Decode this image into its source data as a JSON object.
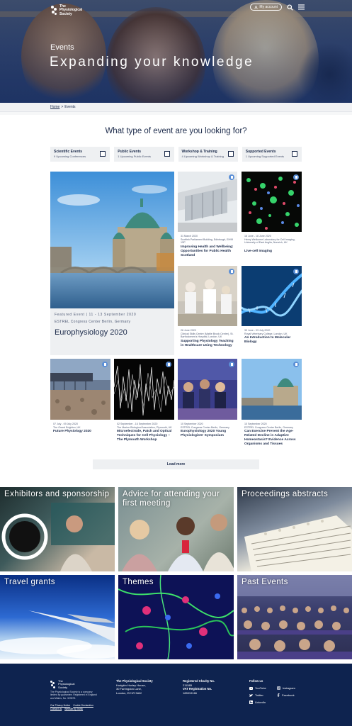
{
  "header": {
    "logo_line1": "The",
    "logo_line2": "Physiological",
    "logo_line3": "Society",
    "my_account": "My account",
    "kicker": "Events",
    "title": "Expanding your knowledge"
  },
  "breadcrumb": {
    "home": "Home",
    "separator": ">",
    "current": "Events"
  },
  "question": "What type of event are you looking for?",
  "filters": [
    {
      "title": "Scientific Events",
      "subtitle": "9 Upcoming Conferences"
    },
    {
      "title": "Public Events",
      "subtitle": "1 Upcoming Public Events"
    },
    {
      "title": "Workshop & Training",
      "subtitle": "4 Upcoming Workshop & Training"
    },
    {
      "title": "Supported Events",
      "subtitle": "1 Upcoming Supported Events"
    }
  ],
  "featured": {
    "kicker": "Featured Event | 11 - 13 September 2020",
    "venue": "ESTREL Congress Center Berlin, Germany",
    "title": "Europhysiology 2020"
  },
  "events": [
    {
      "date": "31 March 2020",
      "venue": "Scottish Parliament Building, Edinburgh, EH99 1SP",
      "title": "Improving Health and Wellbeing: Opportunities for Public Health Scotland"
    },
    {
      "date": "16 June - 18 June 2020",
      "venue": "Henry Wellcome Laboratory for Cell Imaging, University of East Anglia, Norwich, UK",
      "title": "Live-cell Imaging"
    },
    {
      "date": "26 June 2020",
      "venue": "Clinical Skills Centre (Mable Brook Centre), St. Bartholomew's Hospital, London, UK",
      "title": "Supporting Physiology Teaching in Healthcare Using Technology"
    },
    {
      "date": "30 June - 03 July 2020",
      "venue": "Royal Veterinary College, London, UK",
      "title": "An Introduction to Molecular Biology"
    },
    {
      "date": "07 July - 09 July 2020",
      "venue": "The Grand Brighton, UK",
      "title": "Future Physiology 2020"
    },
    {
      "date": "02 September - 16 September 2020",
      "venue": "The Marine Biological Association, Plymouth, UK",
      "title": "Microelectrode, Patch and Optical Techniques for Cell Physiology – The Plymouth Workshop"
    },
    {
      "date": "10 September 2020",
      "venue": "ESTREL Congress Center Berlin, Germany",
      "title": "Europhysiology 2020 Young Physiologists' Symposium"
    },
    {
      "date": "10 September 2020",
      "venue": "ESTREL Congress Center Berlin, Germany",
      "title": "Can Exercise Prevent the Age-Related Decline in Adaptive Homeostasis? Evidence Across Organisms and Tissues"
    }
  ],
  "load_more": "Load more",
  "tiles": [
    {
      "label": "Exhibitors and sponsorship"
    },
    {
      "label": "Advice for attending your first meeting"
    },
    {
      "label": "Proceedings abstracts"
    },
    {
      "label": "Travel grants"
    },
    {
      "label": "Themes"
    },
    {
      "label": "Past Events"
    }
  ],
  "footer": {
    "blurb": "The Physiological Society is a company limited by guarantee. Registered in England and Wales, No. 323575.",
    "links": [
      "Our Privacy Notice",
      "Cookie Declaration",
      "Contact us",
      "Website by Ironic"
    ],
    "address_title": "The Physiological Society",
    "address_lines": [
      "Hodgkin Huxley House,",
      "30 Farringdon Lane,",
      "London, EC1R 3AW"
    ],
    "charity_title": "Registered Charity No.",
    "charity_no": "211585",
    "vat_title": "VAT Registration No.",
    "vat_no": "185319166",
    "follow_title": "Follow us",
    "social": [
      "YouTube",
      "Instagram",
      "Twitter",
      "Facebook",
      "LinkedIn"
    ]
  },
  "colors": {
    "navy": "#0e234f",
    "text": "#1b2a4a",
    "bookmark": "#5b8fd6",
    "panel": "#eef0f2"
  }
}
